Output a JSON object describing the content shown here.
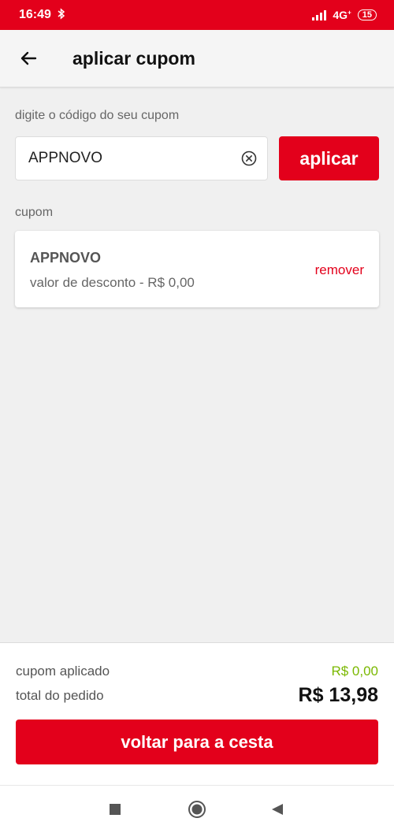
{
  "status_bar": {
    "time": "16:49",
    "network": "4G",
    "network_suffix": "+",
    "battery": "15",
    "icons": [
      "bluetooth-icon",
      "signal-icon",
      "battery-icon"
    ]
  },
  "header": {
    "title": "aplicar cupom",
    "back_icon": "arrow-left-icon"
  },
  "coupon_form": {
    "label": "digite o código do seu cupom",
    "input_value": "APPNOVO",
    "clear_icon": "clear-circle-icon",
    "apply_label": "aplicar"
  },
  "applied_coupon": {
    "section_label": "cupom",
    "code": "APPNOVO",
    "discount_text": "valor de desconto - R$ 0,00",
    "remove_label": "remover"
  },
  "summary": {
    "applied_label": "cupom aplicado",
    "applied_value": "R$ 0,00",
    "total_label": "total do pedido",
    "total_value": "R$ 13,98",
    "button_label": "voltar para a cesta"
  },
  "nav": {
    "icons": [
      "recent-apps-icon",
      "home-icon",
      "back-triangle-icon"
    ]
  },
  "colors": {
    "brand_red": "#e3001b",
    "discount_green": "#7ab800",
    "background": "#f0f0f0"
  }
}
